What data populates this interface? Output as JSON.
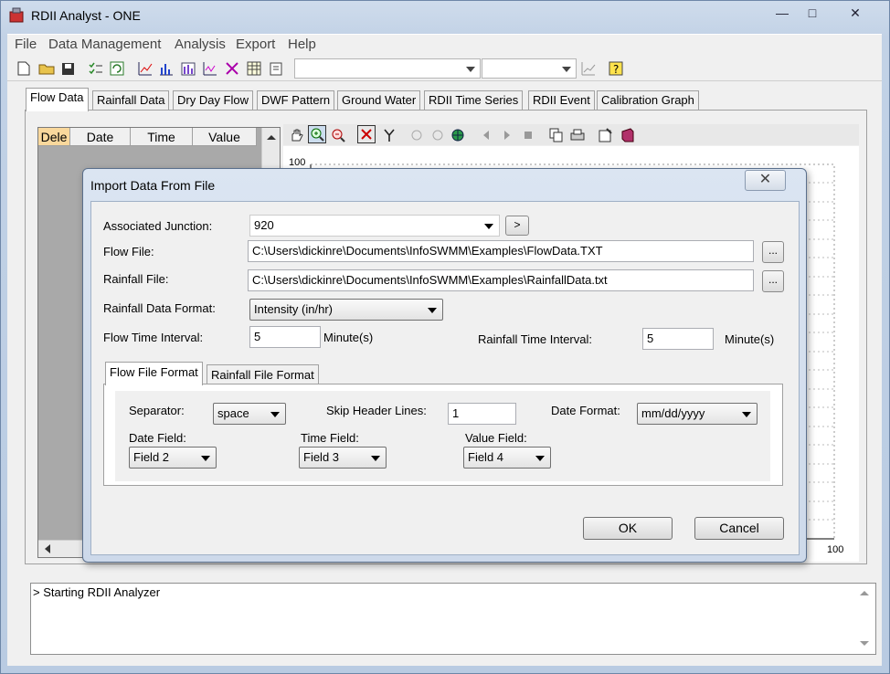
{
  "window": {
    "title": "RDII Analyst - ONE",
    "minimize": "—",
    "maximize": "□",
    "close": "✕"
  },
  "menu": [
    "File",
    "Data Management",
    "Analysis",
    "Export",
    "Help"
  ],
  "toolbar": {
    "combo1": "",
    "combo2": ""
  },
  "tabs": [
    "Flow Data",
    "Rainfall Data",
    "Dry Day Flow",
    "DWF Pattern",
    "Ground Water",
    "RDII Time Series",
    "RDII Event",
    "Calibration Graph"
  ],
  "grid": {
    "columns": [
      "Dele",
      "Date",
      "Time",
      "Value"
    ]
  },
  "chart": {
    "y_top_label": "100",
    "x_right_label": "100"
  },
  "log": {
    "lines": [
      "> Starting RDII Analyzer"
    ]
  },
  "dialog": {
    "title": "Import Data From File",
    "close": "✕",
    "associated_junction": {
      "label": "Associated Junction:",
      "value": "920",
      "go": ">"
    },
    "flow_file": {
      "label": "Flow File:",
      "value": "C:\\Users\\dickinre\\Documents\\InfoSWMM\\Examples\\FlowData.TXT",
      "browse": "..."
    },
    "rainfall_file": {
      "label": "Rainfall File:",
      "value": "C:\\Users\\dickinre\\Documents\\InfoSWMM\\Examples\\RainfallData.txt",
      "browse": "..."
    },
    "rainfall_format": {
      "label": "Rainfall Data Format:",
      "value": "Intensity (in/hr)"
    },
    "flow_interval": {
      "label": "Flow Time Interval:",
      "value": "5",
      "unit": "Minute(s)"
    },
    "rain_interval": {
      "label": "Rainfall Time Interval:",
      "value": "5",
      "unit": "Minute(s)"
    },
    "inner_tabs": [
      "Flow File Format",
      "Rainfall File Format"
    ],
    "separator": {
      "label": "Separator:",
      "value": "space"
    },
    "skip_header": {
      "label": "Skip Header Lines:",
      "value": "1"
    },
    "date_format": {
      "label": "Date Format:",
      "value": "mm/dd/yyyy"
    },
    "date_field": {
      "label": "Date Field:",
      "value": "Field 2"
    },
    "time_field": {
      "label": "Time Field:",
      "value": "Field 3"
    },
    "value_field": {
      "label": "Value Field:",
      "value": "Field 4"
    },
    "ok": "OK",
    "cancel": "Cancel"
  }
}
